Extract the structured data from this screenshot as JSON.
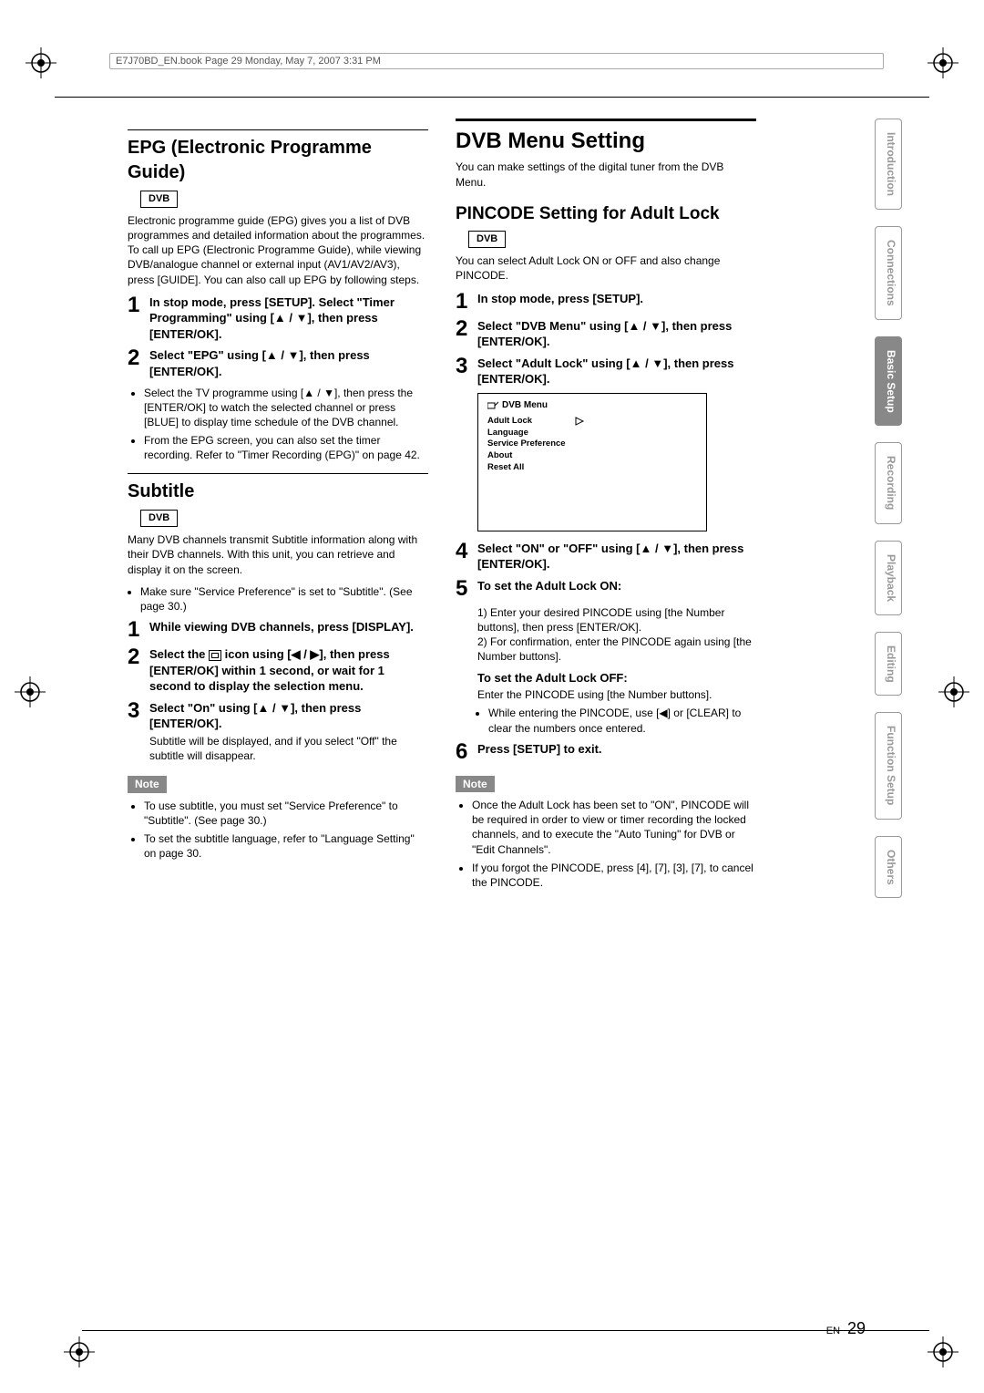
{
  "header": "E7J70BD_EN.book  Page 29  Monday, May 7, 2007  3:31 PM",
  "left": {
    "epg": {
      "title": "EPG (Electronic Programme Guide)",
      "dvb": "DVB",
      "intro": "Electronic programme guide (EPG) gives you a list of DVB programmes and detailed information about the programmes. To call up EPG (Electronic Programme Guide), while viewing DVB/analogue channel or external input (AV1/AV2/AV3), press [GUIDE]. You can also call up EPG by following steps.",
      "step1": "In stop mode, press [SETUP]. Select \"Timer Programming\" using [▲ / ▼], then press [ENTER/OK].",
      "step2": "Select \"EPG\" using [▲ / ▼], then press [ENTER/OK].",
      "bul1": "Select the TV programme using [▲ / ▼], then press the [ENTER/OK] to watch the selected channel or press [BLUE] to display time schedule of the DVB channel.",
      "bul2": "From the EPG screen, you can also set the timer recording. Refer to \"Timer Recording (EPG)\" on page 42."
    },
    "subtitle": {
      "title": "Subtitle",
      "dvb": "DVB",
      "intro": "Many DVB channels transmit Subtitle information along with their DVB channels. With this unit, you can retrieve and display it on the screen.",
      "bul0": "Make sure \"Service Preference\" is set to \"Subtitle\". (See page 30.)",
      "step1": "While viewing DVB channels, press [DISPLAY].",
      "step2a": "Select the ",
      "step2b": " icon using [◀ / ▶], then press [ENTER/OK] within 1 second, or wait for 1 second to display the selection menu.",
      "step3": "Select \"On\" using [▲ / ▼], then press [ENTER/OK].",
      "step3_plain": "Subtitle will be displayed, and if you select \"Off\" the subtitle will disappear.",
      "note": "Note",
      "note_b1": "To use subtitle, you must set \"Service Preference\" to \"Subtitle\". (See page 30.)",
      "note_b2": "To set the subtitle language, refer to \"Language Setting\" on page 30."
    }
  },
  "right": {
    "dvbmenu": {
      "title": "DVB Menu Setting",
      "intro": "You can make settings of the digital tuner from the DVB Menu."
    },
    "pincode": {
      "title": "PINCODE Setting for Adult Lock",
      "dvb": "DVB",
      "intro": "You can select Adult Lock ON or OFF and also change PINCODE.",
      "step1": "In stop mode, press [SETUP].",
      "step2": "Select \"DVB Menu\" using [▲ / ▼], then press [ENTER/OK].",
      "step3": "Select \"Adult Lock\" using [▲ / ▼], then press [ENTER/OK].",
      "menu_title": "DVB Menu",
      "menu_items": {
        "i0": "Adult Lock",
        "i1": "Language",
        "i2": "Service Preference",
        "i3": "About",
        "i4": "Reset All"
      },
      "step4": "Select \"ON\" or \"OFF\" using [▲ / ▼], then press [ENTER/OK].",
      "step5": "To set the Adult Lock ON:",
      "step5_1": "1) Enter your desired PINCODE using [the Number buttons], then press [ENTER/OK].",
      "step5_2": "2) For confirmation, enter the PINCODE again using [the Number buttons].",
      "off_head": "To set the Adult Lock OFF:",
      "off_text": "Enter the PINCODE using [the Number buttons].",
      "off_bul": "While entering the PINCODE, use [◀] or [CLEAR] to clear the numbers once entered.",
      "step6": "Press [SETUP] to exit.",
      "note": "Note",
      "note_b1": "Once the Adult Lock has been set to \"ON\", PINCODE will be required in order to view or timer recording the locked channels, and to execute the \"Auto Tuning\" for DVB or \"Edit Channels\".",
      "note_b2": "If you forgot the PINCODE, press [4], [7], [3], [7], to cancel the PINCODE."
    }
  },
  "tabs": {
    "t0": "Introduction",
    "t1": "Connections",
    "t2": "Basic Setup",
    "t3": "Recording",
    "t4": "Playback",
    "t5": "Editing",
    "t6": "Function Setup",
    "t7": "Others"
  },
  "page": {
    "en": "EN",
    "num": "29"
  }
}
